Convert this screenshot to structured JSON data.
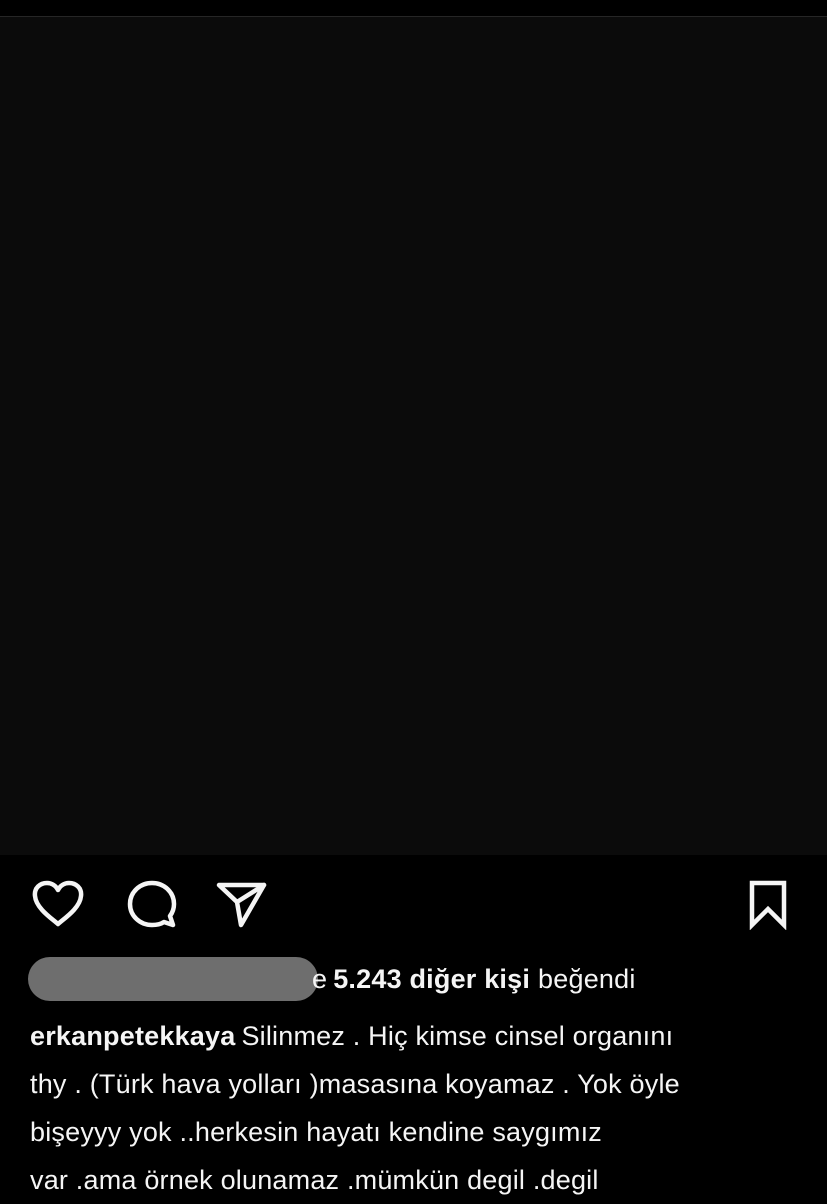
{
  "post": {
    "likes": {
      "partial_text": "e",
      "count": "5.243 diğer kişi",
      "suffix": "beğendi"
    },
    "caption": {
      "username": "erkanpetekkaya",
      "lines": [
        "Silinmez . Hiç kimse cinsel organını",
        "thy . (Türk hava yolları )masasına koyamaz . Yok öyle",
        "bişeyyy yok ..herkesin hayatı kendine saygımız",
        "var .ama örnek olunamaz .mümkün degil .degil"
      ]
    }
  },
  "icons": {
    "like": "heart-icon",
    "comment": "comment-icon",
    "share": "paper-plane-icon",
    "save": "bookmark-icon"
  },
  "colors": {
    "background": "#000000",
    "text": "#f5f5f5",
    "redaction": "#6e6e6e"
  }
}
